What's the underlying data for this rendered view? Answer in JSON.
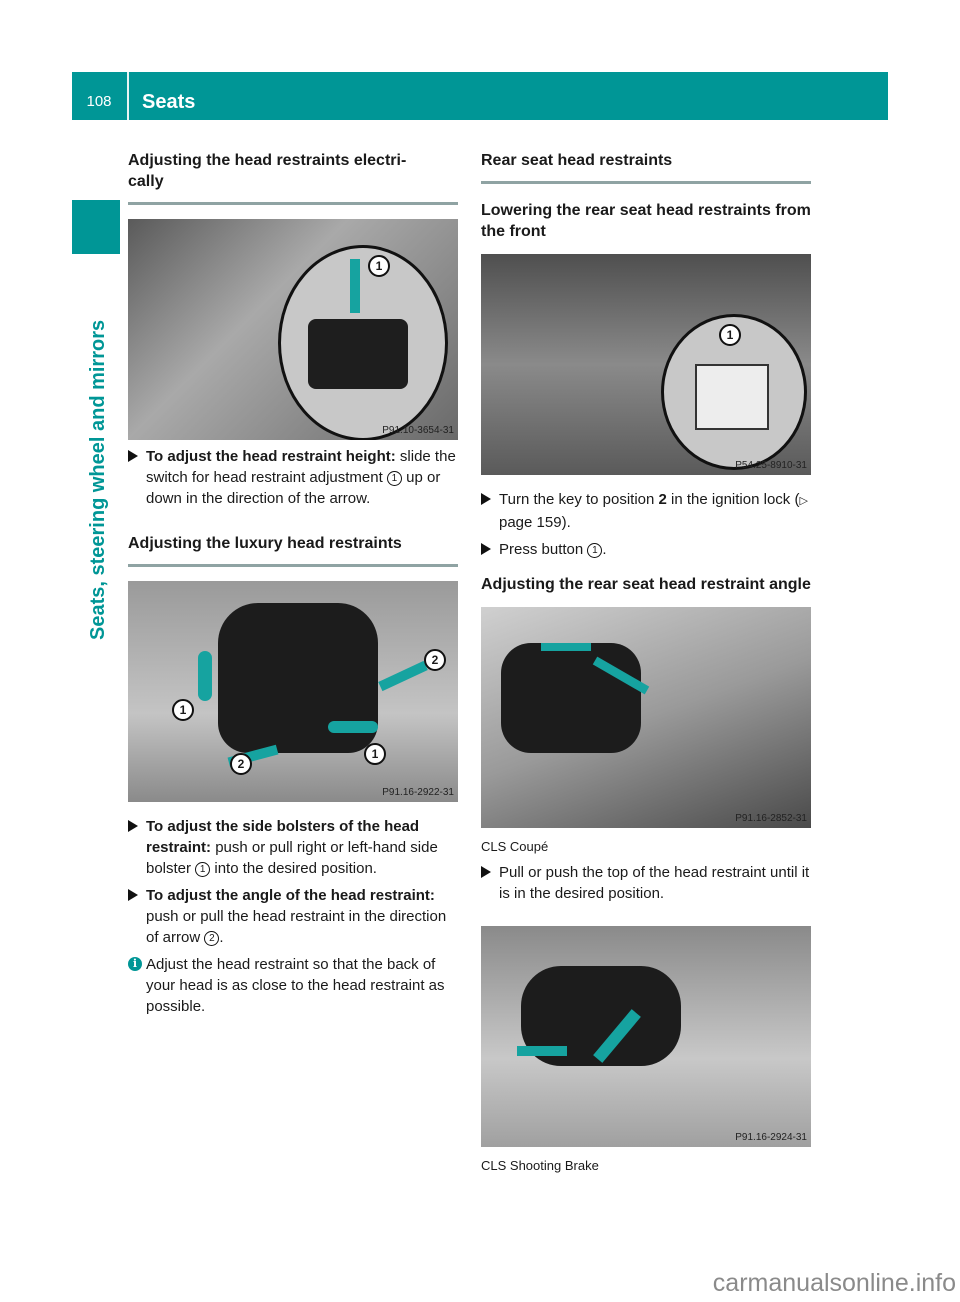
{
  "header": {
    "page_number": "108",
    "title": "Seats"
  },
  "side_tab": {
    "label": "Seats, steering wheel and mirrors",
    "color": "#009696"
  },
  "left_column": {
    "section1": {
      "title": "Adjusting the head restraints electri-\ncally",
      "figure": {
        "code": "P91.10-3654-31",
        "callouts": [
          "1"
        ]
      },
      "steps": [
        {
          "bold": "To adjust the head restraint height:",
          "text": " slide the switch for head restraint adjustment ",
          "ref": "1",
          "after": " up or down in the direction of the arrow."
        }
      ]
    },
    "section2": {
      "title": "Adjusting the luxury head restraints",
      "figure": {
        "code": "P91.16-2922-31",
        "callouts": [
          "1",
          "2"
        ]
      },
      "steps": [
        {
          "bold": "To adjust the side bolsters of the head restraint:",
          "text": " push or pull right or left-hand side bolster ",
          "ref": "1",
          "after": " into the desired position."
        },
        {
          "bold": "To adjust the angle of the head restraint:",
          "text": " push or pull the head restraint in the direction of arrow ",
          "ref": "2",
          "after": "."
        }
      ],
      "info": "Adjust the head restraint so that the back of your head is as close to the head restraint as possible."
    }
  },
  "right_column": {
    "section_title": "Rear seat head restraints",
    "sub1": {
      "title": "Lowering the rear seat head restraints from the front",
      "figure": {
        "code": "P54.25-8910-31",
        "callouts": [
          "1"
        ]
      },
      "steps": [
        {
          "text": "Turn the key to position ",
          "bold": "2",
          "after": " in the ignition lock (",
          "link_icon": "▷",
          "link": " page 159",
          "end": ")."
        },
        {
          "text": "Press button ",
          "ref": "1",
          "after": "."
        }
      ]
    },
    "sub2": {
      "title": "Adjusting the rear seat head restraint angle",
      "figure1": {
        "code": "P91.16-2852-31",
        "caption": "CLS Coupé"
      },
      "steps": [
        {
          "text": "Pull or push the top of the head restraint until it is in the desired position."
        }
      ],
      "figure2": {
        "code": "P91.16-2924-31",
        "caption": "CLS Shooting Brake"
      }
    }
  },
  "watermark": "carmanualsonline.info"
}
